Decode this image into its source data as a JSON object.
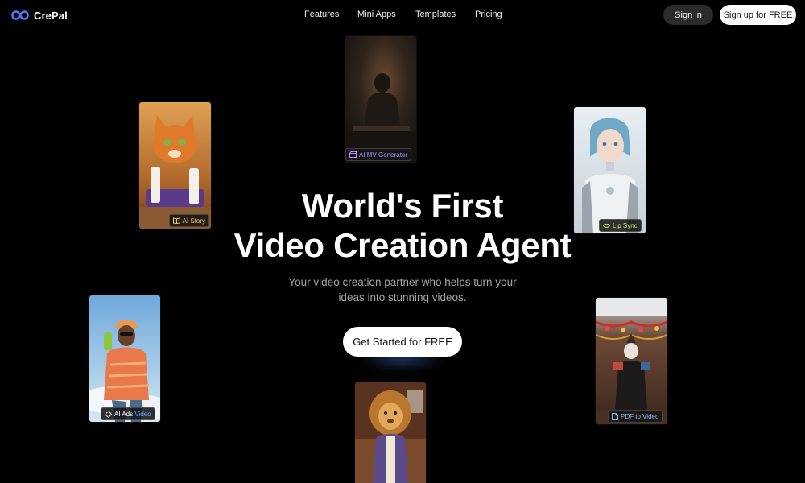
{
  "header": {
    "logo": {
      "text": "CrePal",
      "icon": "infinity-logo-icon",
      "color": "#4f7cff"
    },
    "nav": [
      {
        "label": "Features"
      },
      {
        "label": "Mini Apps"
      },
      {
        "label": "Templates"
      },
      {
        "label": "Pricing"
      }
    ],
    "sign_in_label": "Sign in",
    "sign_up_label": "Sign up for FREE"
  },
  "hero": {
    "title_line1": "World's First",
    "title_line2": "Video Creation Agent",
    "subtitle_line1": "Your video creation partner who helps turn your",
    "subtitle_line2": "ideas into stunning videos.",
    "cta_label": "Get Started for FREE"
  },
  "cards": [
    {
      "id": "ai-story",
      "label": "AI Story",
      "icon": "book-icon",
      "label_color": "#f2c96b"
    },
    {
      "id": "ai-mv-generator",
      "label": "AI MV Generator",
      "icon": "clapper-icon",
      "label_color": "#b98cff"
    },
    {
      "id": "lip-sync",
      "label": "Lip Sync",
      "icon": "lips-icon",
      "label_color": "#c8f06a"
    },
    {
      "id": "ai-ads-video",
      "label_part1": "AI Ads ",
      "label_part2": "Video",
      "icon": "tag-icon",
      "label_color": "#ffffff",
      "label_accent_color": "#6ea8ff"
    },
    {
      "id": "pdf-to-video",
      "label": "PDF to Video",
      "icon": "document-icon",
      "label_color": "#8fb4ff"
    },
    {
      "id": "lion-video",
      "icon": "none"
    }
  ]
}
